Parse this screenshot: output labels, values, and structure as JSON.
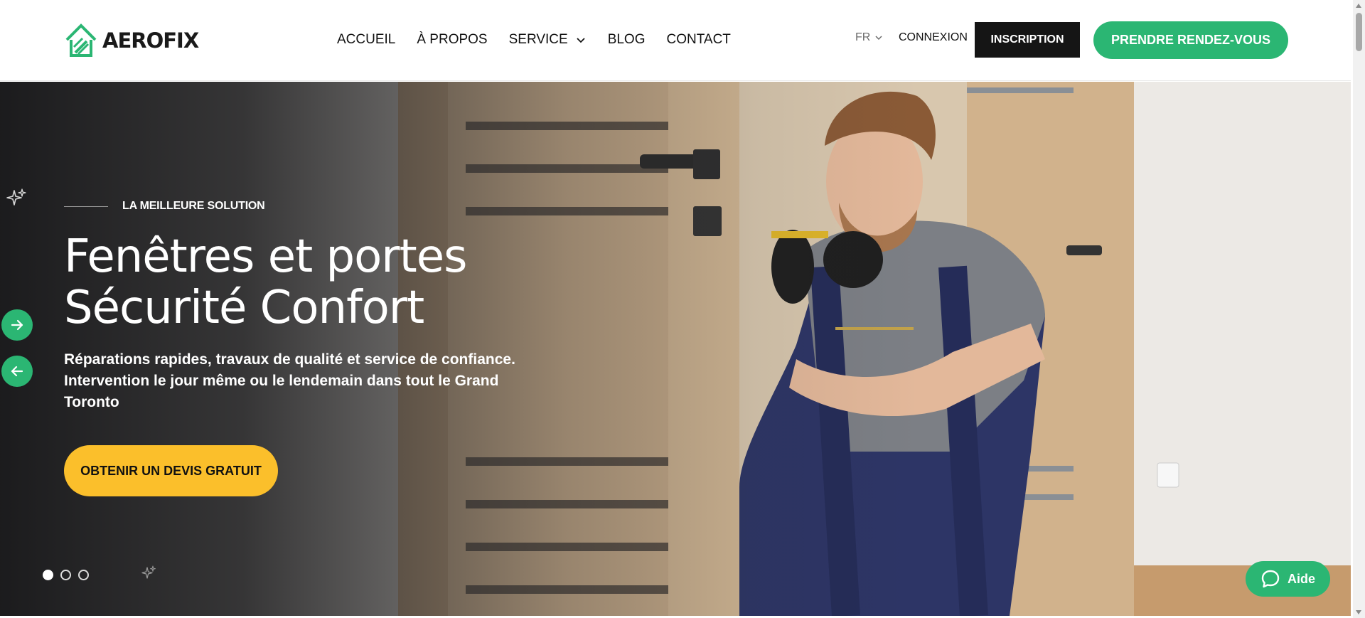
{
  "brand": {
    "name": "AEROFIX",
    "logo_icon": "house-roof-logo-icon",
    "accent_color": "#2bb673",
    "cta_color": "#fbbf2b",
    "dark_color": "#151515"
  },
  "nav": {
    "items": [
      {
        "label": "ACCUEIL"
      },
      {
        "label": "À PROPOS"
      },
      {
        "label": "SERVICE",
        "has_dropdown": true
      },
      {
        "label": "BLOG"
      },
      {
        "label": "CONTACT"
      }
    ]
  },
  "header": {
    "language": "FR",
    "login_label": "CONNEXION",
    "signup_label": "INSCRIPTION",
    "appointment_label": "PRENDRE RENDEZ-VOUS"
  },
  "hero": {
    "eyebrow": "LA MEILLEURE SOLUTION",
    "title_line1": "Fenêtres et portes",
    "title_line2": "Sécurité Confort",
    "subtitle": "Réparations rapides, travaux de qualité et service de confiance. Intervention le jour même ou le lendemain dans tout le Grand Toronto",
    "cta_label": "OBTENIR UN DEVIS GRATUIT",
    "slide_count": 3,
    "active_slide": 1,
    "icons": [
      "arrow-right-icon",
      "arrow-left-icon",
      "sparkle-icon"
    ]
  },
  "help_widget": {
    "label": "Aide",
    "icon": "chat-bubble-icon"
  }
}
